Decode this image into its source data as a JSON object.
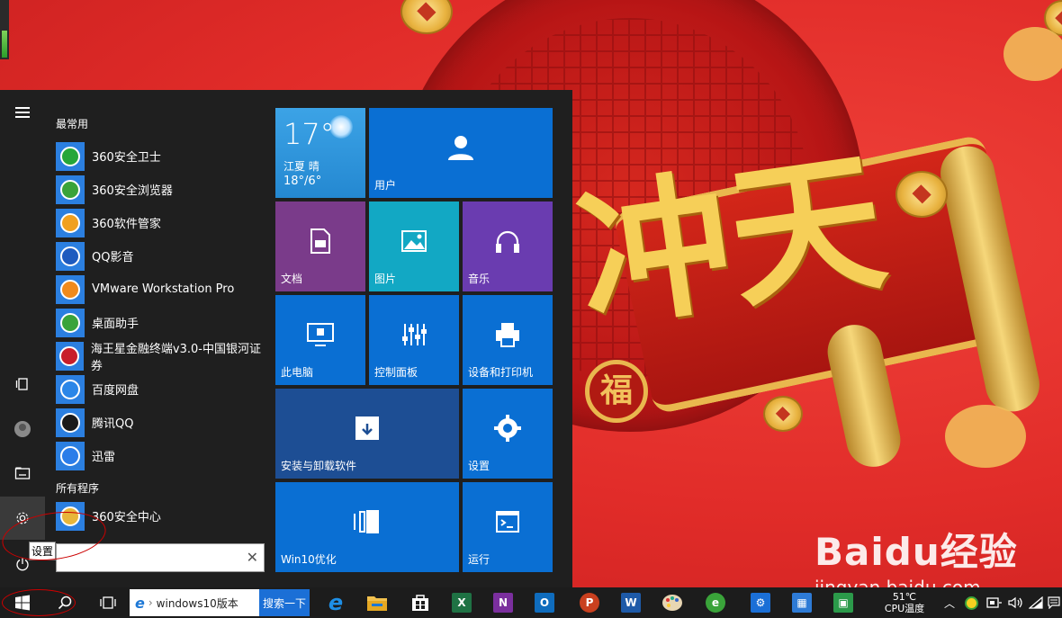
{
  "start_menu": {
    "tooltip": "设置",
    "most_used_header": "最常用",
    "all_programs_header": "所有程序",
    "most_used": [
      {
        "label": "360安全卫士",
        "icon": "360-safe-guard-icon",
        "color": "#26a63a"
      },
      {
        "label": "360安全浏览器",
        "icon": "360-browser-icon",
        "color": "#3aa33a"
      },
      {
        "label": "360软件管家",
        "icon": "360-software-manager-icon",
        "color": "#f0a020"
      },
      {
        "label": "QQ影音",
        "icon": "qq-player-icon",
        "color": "#1e5bbf"
      },
      {
        "label": "VMware Workstation Pro",
        "icon": "vmware-icon",
        "color": "#f08a1c"
      },
      {
        "label": "桌面助手",
        "icon": "desktop-assistant-icon",
        "color": "#3aa33a"
      },
      {
        "label": "海王星金融终端v3.0-中国银河证券",
        "icon": "neptune-finance-icon",
        "color": "#c81e2a"
      },
      {
        "label": "百度网盘",
        "icon": "baidu-netdisk-icon",
        "color": "#2b86e8"
      },
      {
        "label": "腾讯QQ",
        "icon": "tencent-qq-icon",
        "color": "#1a1a1a"
      },
      {
        "label": "迅雷",
        "icon": "xunlei-icon",
        "color": "#2b7de9"
      }
    ],
    "all_programs": [
      {
        "label": "360安全中心",
        "icon": "folder-icon",
        "color": "#e8b63a"
      }
    ],
    "tiles": {
      "weather": {
        "temp": "17°",
        "city": "江夏  晴",
        "range": "18°/6°"
      },
      "user": "用户",
      "documents": "文档",
      "pictures": "图片",
      "music": "音乐",
      "this_pc": "此电脑",
      "control_panel": "控制面板",
      "devices_printers": "设备和打印机",
      "install_uninstall": "安装与卸载软件",
      "settings": "设置",
      "win10_optimize": "Win10优化",
      "run": "运行"
    },
    "colors": {
      "tile_blue": "#0a6fd3",
      "tile_purple": "#7a3b8a",
      "tile_cyan": "#12a8c4",
      "tile_violet": "#6a3cb0",
      "tile_dark_blue": "#1d4e94"
    }
  },
  "taskbar": {
    "search_query": "windows10版本",
    "search_button": "搜索一下",
    "cpu_temp": "51℃",
    "cpu_label": "CPU温度"
  },
  "desktop": {
    "watermark": "Baidu经验",
    "watermark_url": "jingyan.baidu.com",
    "banner_text": "冲天",
    "seal_text": "福"
  }
}
